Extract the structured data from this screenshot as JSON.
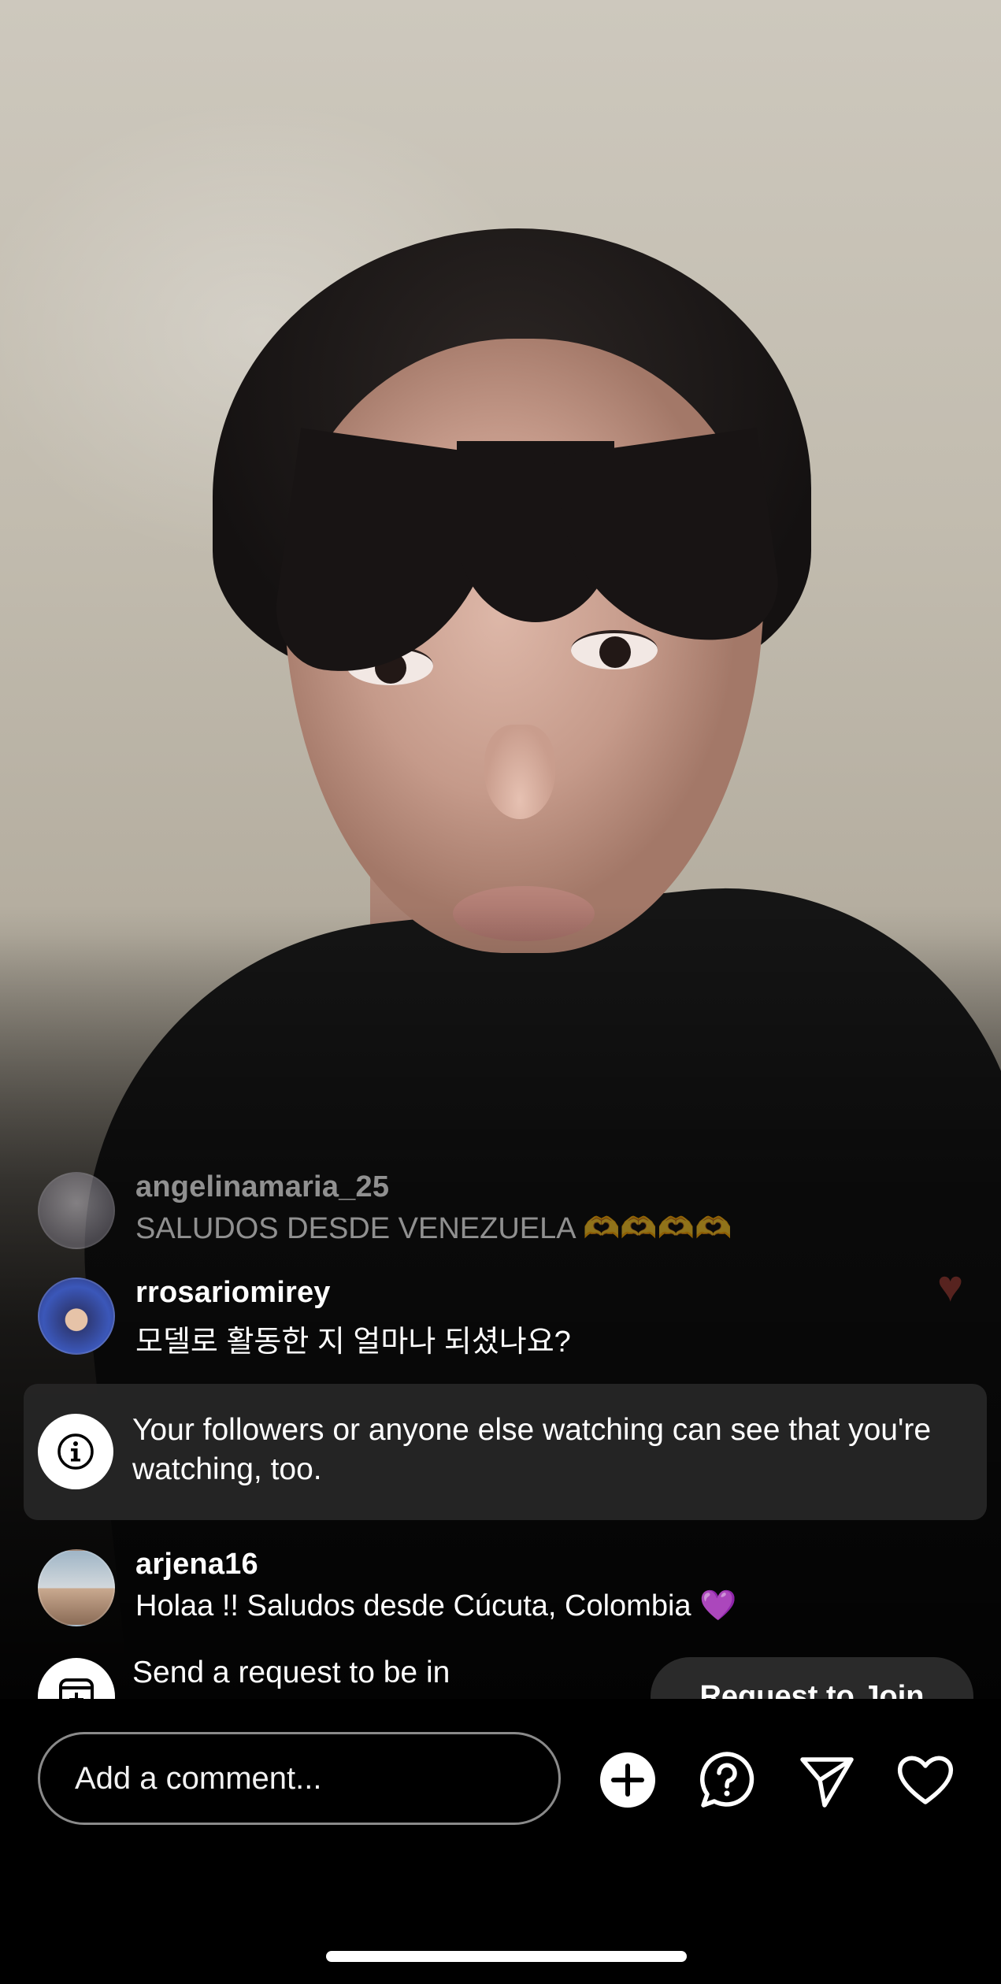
{
  "comments": [
    {
      "username": "angelinamaria_25",
      "text": "SALUDOS DESDE VENEZUELA 🫶🫶🫶🫶"
    },
    {
      "username": "rrosariomirey",
      "text": "모델로 활동한 지 얼마나 되셨나요?"
    },
    {
      "username": "arjena16",
      "text": "Holaa !! Saludos desde Cúcuta, Colombia 💜"
    }
  ],
  "notice": {
    "text": "Your followers or anyone else watching can see that you're watching, too."
  },
  "join_request": {
    "text": "Send a request to be in",
    "button_label": "Request to Join"
  },
  "composer": {
    "placeholder": "Add a comment..."
  },
  "icons": {
    "info": "info-icon",
    "add": "plus-circle-icon",
    "question": "question-bubble-icon",
    "send": "paper-plane-icon",
    "like": "heart-outline-icon",
    "join": "add-video-icon"
  },
  "colors": {
    "background": "#000000",
    "notice_bg": "#262626",
    "button_bg": "#2a2a2a",
    "text": "#ffffff"
  }
}
